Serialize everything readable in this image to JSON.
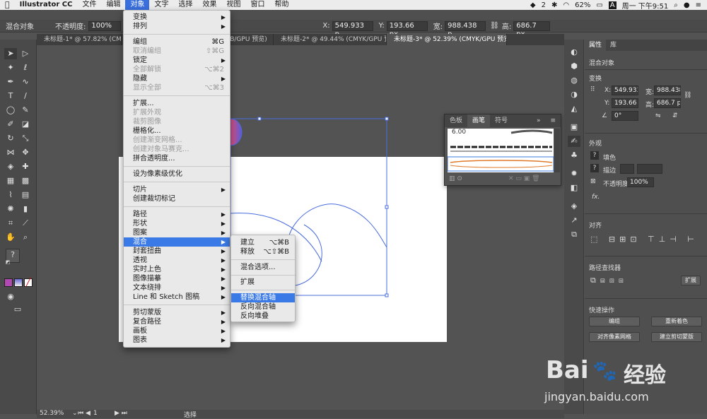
{
  "menubar": {
    "app": "Illustrator CC",
    "items": [
      "文件",
      "编辑",
      "对象",
      "文字",
      "选择",
      "效果",
      "视图",
      "窗口",
      "帮助"
    ],
    "active": "对象",
    "status": {
      "wechat": "2",
      "battery": "62%",
      "input": "A",
      "clock": "周一 下午9:51"
    }
  },
  "controlbar": {
    "selection": "混合对象",
    "opacity_label": "不透明度:",
    "opacity_value": "100%",
    "x_label": "X:",
    "x_value": "549.933 p",
    "y_label": "Y:",
    "y_value": "193.66 px",
    "w_label": "宽:",
    "w_value": "988.438 p",
    "h_label": "高:",
    "h_value": "686.7 px"
  },
  "tabs": [
    "未标题-1* @ 57.82% (CMYK/GPU",
    "RGB/GPU 预览)",
    "未标题-2* @ 49.44% (CMYK/GPU 预览)",
    "未标题-3* @ 52.39% (CMYK/GPU 预览)"
  ],
  "object_menu": {
    "items": [
      {
        "label": "变换",
        "arrow": true
      },
      {
        "label": "排列",
        "arrow": true
      },
      {
        "sep": true
      },
      {
        "label": "编组",
        "shortcut": "⌘G"
      },
      {
        "label": "取消编组",
        "shortcut": "⇧⌘G",
        "disabled": true
      },
      {
        "label": "锁定",
        "arrow": true
      },
      {
        "label": "全部解锁",
        "shortcut": "⌥⌘2",
        "disabled": true
      },
      {
        "label": "隐藏",
        "arrow": true
      },
      {
        "label": "显示全部",
        "shortcut": "⌥⌘3",
        "disabled": true
      },
      {
        "sep": true
      },
      {
        "label": "扩展..."
      },
      {
        "label": "扩展外观",
        "disabled": true
      },
      {
        "label": "裁剪图像",
        "disabled": true
      },
      {
        "label": "栅格化..."
      },
      {
        "label": "创建渐变网格...",
        "disabled": true
      },
      {
        "label": "创建对象马赛克...",
        "disabled": true
      },
      {
        "label": "拼合透明度..."
      },
      {
        "sep": true
      },
      {
        "label": "设为像素级优化"
      },
      {
        "sep": true
      },
      {
        "label": "切片",
        "arrow": true
      },
      {
        "label": "创建裁切标记"
      },
      {
        "sep": true
      },
      {
        "label": "路径",
        "arrow": true
      },
      {
        "label": "形状",
        "arrow": true
      },
      {
        "label": "图案",
        "arrow": true
      },
      {
        "label": "混合",
        "arrow": true,
        "highlight": true
      },
      {
        "label": "封套扭曲",
        "arrow": true
      },
      {
        "label": "透视",
        "arrow": true
      },
      {
        "label": "实时上色",
        "arrow": true
      },
      {
        "label": "图像描摹",
        "arrow": true
      },
      {
        "label": "文本绕排",
        "arrow": true
      },
      {
        "label": "Line 和 Sketch 图稿",
        "arrow": true
      },
      {
        "sep": true
      },
      {
        "label": "剪切蒙版",
        "arrow": true
      },
      {
        "label": "复合路径",
        "arrow": true
      },
      {
        "label": "画板",
        "arrow": true
      },
      {
        "label": "图表",
        "arrow": true
      }
    ]
  },
  "blend_submenu": {
    "items": [
      {
        "label": "建立",
        "shortcut": "⌥⌘B"
      },
      {
        "label": "释放",
        "shortcut": "⌥⇧⌘B"
      },
      {
        "sep": true
      },
      {
        "label": "混合选项..."
      },
      {
        "sep": true
      },
      {
        "label": "扩展"
      },
      {
        "sep": true
      },
      {
        "label": "替换混合轴",
        "highlight": true
      },
      {
        "label": "反向混合轴"
      },
      {
        "label": "反向堆叠"
      }
    ]
  },
  "brush_panel": {
    "tabs": [
      "色板",
      "画笔",
      "符号"
    ],
    "active_tab": "画笔",
    "value": "6.00"
  },
  "properties": {
    "tabs": [
      "属性",
      "库"
    ],
    "object_type": "混合对象",
    "transform_title": "变换",
    "x_label": "X:",
    "x_value": "549.933",
    "y_label": "Y:",
    "y_value": "193.66 p",
    "w_label": "宽:",
    "w_value": "988.438",
    "h_label": "高:",
    "h_value": "686.7 p",
    "angle_value": "0°",
    "appearance_title": "外观",
    "fill_label": "填色",
    "stroke_label": "描边",
    "opacity_label": "不透明度",
    "opacity_value": "100%",
    "fx_label": "fx.",
    "align_title": "对齐",
    "pathfinder_title": "路径查找器",
    "expand_btn": "扩展",
    "quick_title": "快速操作",
    "btn_edit": "编组",
    "btn_recolor": "重新着色",
    "btn_pixel": "对齐像素网格",
    "btn_clip": "建立剪切蒙版"
  },
  "statusbar": {
    "zoom": "52.39%",
    "page": "1",
    "mode": "选择"
  },
  "watermark": {
    "brand": "Bai",
    "brand2": "经验",
    "url": "jingyan.baidu.com"
  }
}
